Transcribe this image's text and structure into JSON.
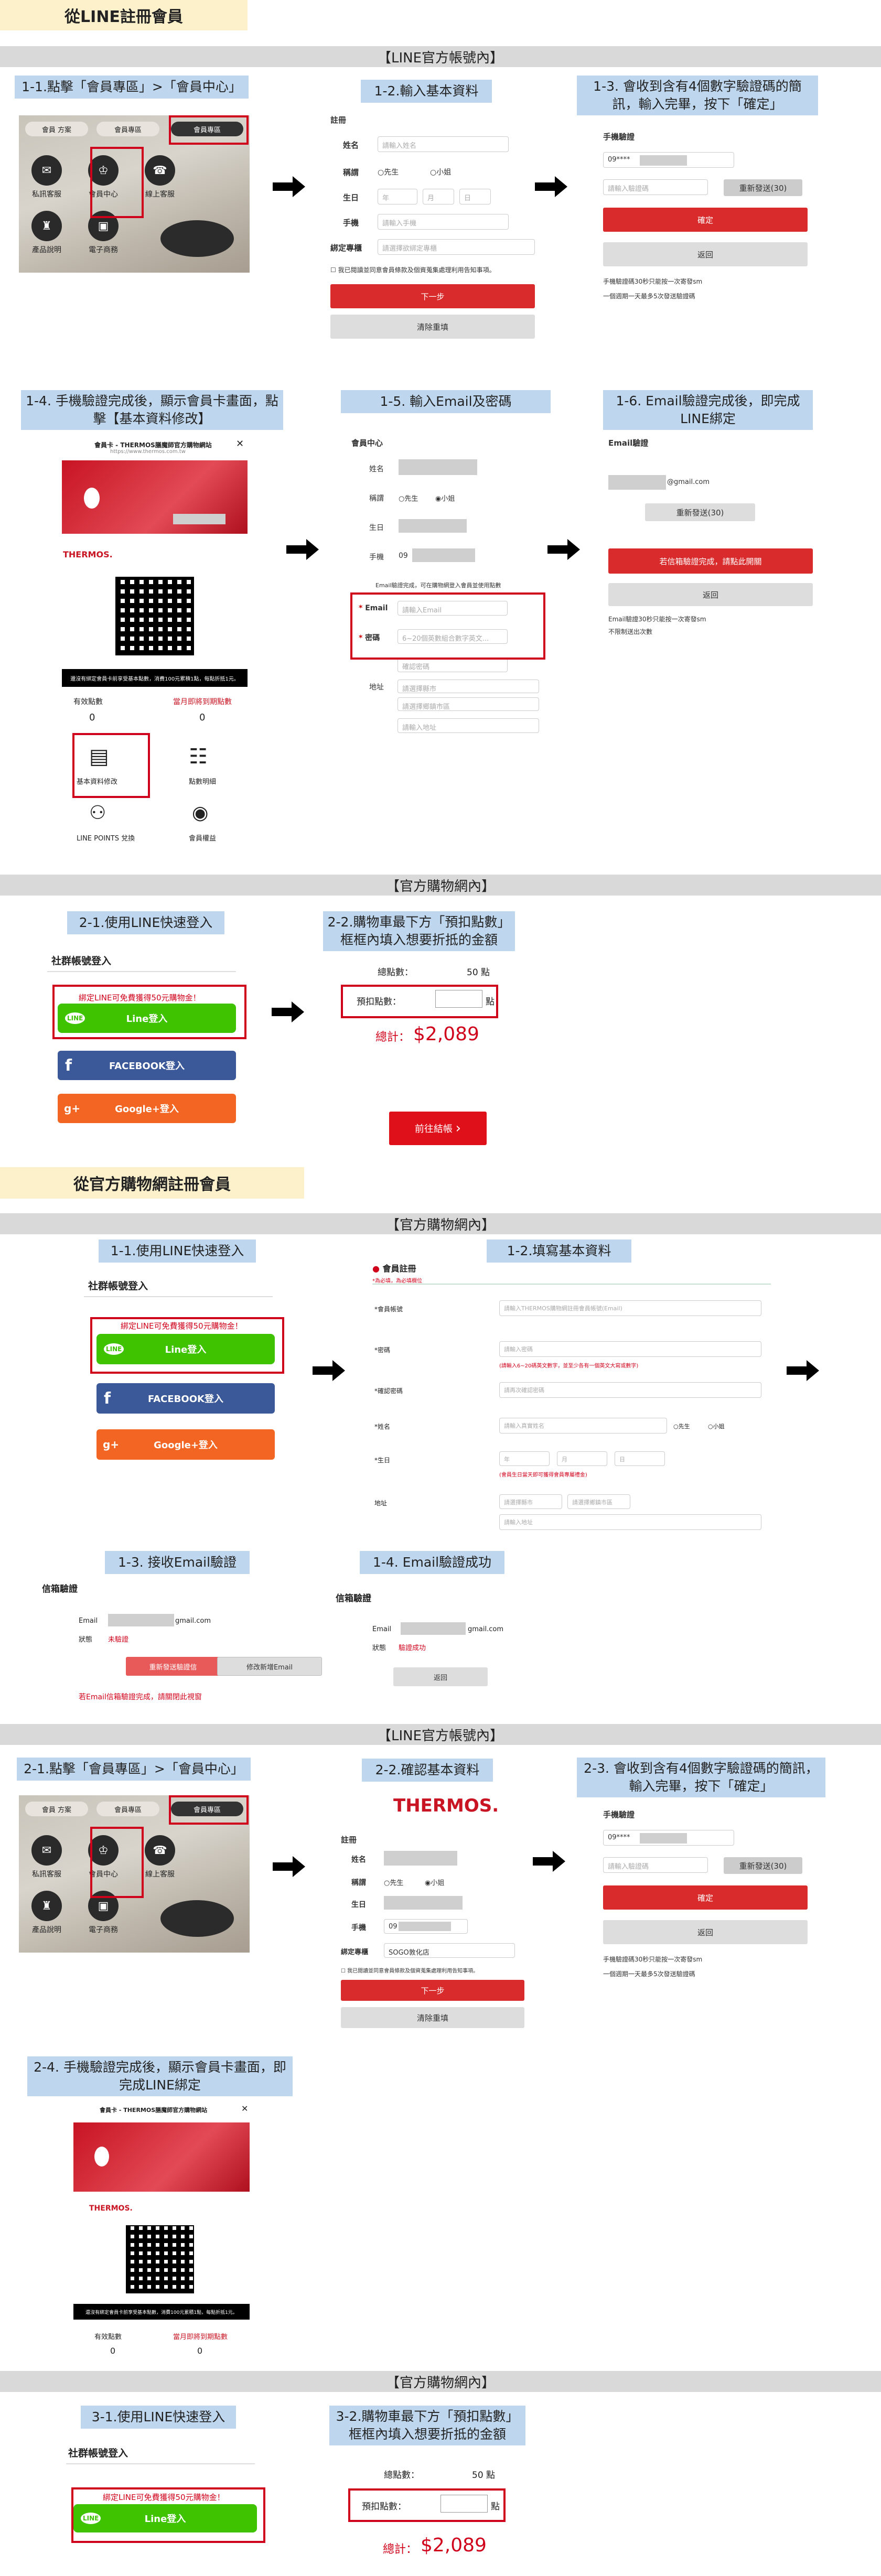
{
  "s1": {
    "title": "從LINE註冊會員",
    "band1": "【LINE官方帳號內】",
    "band2": "【官方購物網內】"
  },
  "s2": {
    "title": "從官方購物網註冊會員",
    "band1": "【官方購物網內】",
    "band2": "【LINE官方帳號內】",
    "band3": "【官方購物網內】"
  },
  "cap": {
    "c11": "1-1.點擊「會員專區」>「會員中心」",
    "c12": "1-2.輸入基本資料",
    "c13": "1-3. 會收到含有4個數字驗證碼的簡訊，輸入完畢，按下「確定」",
    "c14": "1-4. 手機驗證完成後，顯示會員卡畫面，點擊【基本資料修改】",
    "c15": "1-5. 輸入Email及密碼",
    "c16": "1-6. Email驗證完成後，即完成LINE綁定",
    "c21": "2-1.使用LINE快速登入",
    "c22": "2-2.購物車最下方「預扣點數」框框內填入想要折抵的金額",
    "d11": "1-1.使用LINE快速登入",
    "d12": "1-2.填寫基本資料",
    "d13": "1-3. 接收Email驗證",
    "d14": "1-4. Email驗證成功",
    "e21": "2-1.點擊「會員專區」>「會員中心」",
    "e22": "2-2.確認基本資料",
    "e23": "2-3. 會收到含有4個數字驗證碼的簡訊，輸入完畢，按下「確定」",
    "e24": "2-4. 手機驗證完成後，顯示會員卡畫面，即完成LINE綁定",
    "f31": "3-1.使用LINE快速登入",
    "f32": "3-2.購物車最下方「預扣點數」框框內填入想要折抵的金額"
  },
  "richmenu": {
    "tab1": "會員 方案",
    "tab2": "會員專區",
    "tab3": "會員專區",
    "i1": "私訊客服",
    "i2": "會員中心",
    "i3": "線上客服",
    "i4": "產品說明",
    "i5": "電子商務"
  },
  "reg": {
    "header": "註冊",
    "name_l": "姓名",
    "name_ph": "請輸入姓名",
    "title_l": "稱謂",
    "mr": "先生",
    "ms": "小姐",
    "bday_l": "生日",
    "y": "年",
    "m": "月",
    "d": "日",
    "phone_l": "手機",
    "phone_ph": "請輸入手機",
    "store_l": "綁定專櫃",
    "store_ph": "請選擇欲綁定專櫃",
    "agree": "我已閱讀並同意會員條款及個資蒐集處理利用告知事項。",
    "next": "下一步",
    "clear": "清除重填",
    "store_val": "SOGO敦化店",
    "phone_val": "09"
  },
  "verify": {
    "header": "手機驗證",
    "phone_val": "09****",
    "code_ph": "請輸入驗證碼",
    "resend": "重新發送(30)",
    "ok": "確定",
    "back": "返回",
    "note1": "手機驗證碼30秒只能按一次寄發sm",
    "note2": "一個週期一天最多5次發送驗證碼"
  },
  "card": {
    "title": "會員卡 - THERMOS膳魔師官方購物網站",
    "sub": "https://www.thermos.com.tw",
    "pts_label": "有效點數",
    "pts_val": "0",
    "exp_label": "當月即將到期點數",
    "exp_val": "0",
    "notice": "還沒有綁定會員卡前享受基本點數，消費100元累積1點，每點折抵1元。",
    "m1": "基本資料修改",
    "m2": "點數明細",
    "m3": "LINE POINTS 兌換",
    "m4": "會員權益"
  },
  "mc": {
    "header": "會員中心",
    "name_l": "姓名",
    "title_l": "稱謂",
    "bday_l": "生日",
    "phone_l": "手機",
    "phone_val": "09",
    "note": "Email驗證完成，可在購物網登入會員並使用點數",
    "email_l": "Email",
    "email_ph": "請輸入Email",
    "pw_l": "密碼",
    "pw_ph": "6~20個英數組合數字英文...",
    "pw2_ph": "確認密碼",
    "addr_l": "地址",
    "city": "請選擇縣市",
    "dist": "請選擇鄉鎮市區",
    "addr_ph": "請輸入地址"
  },
  "emv": {
    "header": "Email驗證",
    "email_suffix": "@gmail.com",
    "resend": "重新發送(30)",
    "confirm": "若信箱驗證完成，請點此開關",
    "back": "返回",
    "note1": "Email驗證30秒只能按一次寄發sm",
    "note2": "不限制送出次數"
  },
  "login": {
    "head": "社群帳號登入",
    "promo": "綁定LINE可免費獲得50元購物金！",
    "line": "Line登入",
    "fb": "FACEBOOK登入",
    "google": "Google+登入"
  },
  "cart": {
    "total_pts_l": "總點數：",
    "total_pts_v": "50 點",
    "deduct_l": "預扣點數：",
    "deduct_unit": "點",
    "sum_l": "總計：",
    "sum_v": "$2,089",
    "checkout": "前往結帳"
  },
  "shopreg": {
    "header": "會員註冊",
    "req": "*為必填，為必填欄位",
    "email_l": "*會員帳號",
    "email_ph": "請輸入THERMOS購物網註冊會員帳號(Email)",
    "pw_l": "*密碼",
    "pw_ph": "請輸入密碼",
    "pw_hint": "(請輸入6~20碼英文數字，並至少各有一個英文大寫或數字)",
    "pw2_l": "*確認密碼",
    "pw2_ph": "請再次確認密碼",
    "name_l": "*姓名",
    "name_ph": "請輸入真實姓名",
    "mr": "先生",
    "ms": "小姐",
    "bday_l": "*生日",
    "bday_hint": "(會員生日當天即可獲得會員專屬禮金)",
    "y": "年",
    "m": "月",
    "d": "日",
    "addr_l": "地址",
    "city": "請選擇縣市",
    "dist": "請選擇鄉鎮市區",
    "addr_ph": "請輸入地址"
  },
  "mailv": {
    "head": "信箱驗證",
    "email_l": "Email",
    "email_suffix": "gmail.com",
    "state_l": "狀態",
    "state_v": "未驗證",
    "send": "重新發送驗證信",
    "change": "修改新增Email",
    "warn": "若Email信箱驗證完成，請關閉此視窗",
    "state_ok": "驗證成功",
    "back": "返回"
  },
  "thermos": {
    "logo": "THERMOS."
  },
  "colors": {
    "red": "#d0021b",
    "caption_bg": "#bfd7ee",
    "band_bg": "#d9d9d9",
    "title_bg": "#fdf1cc",
    "line_green": "#3fc300",
    "fb_blue": "#3b5998",
    "google_orange": "#f26522"
  }
}
